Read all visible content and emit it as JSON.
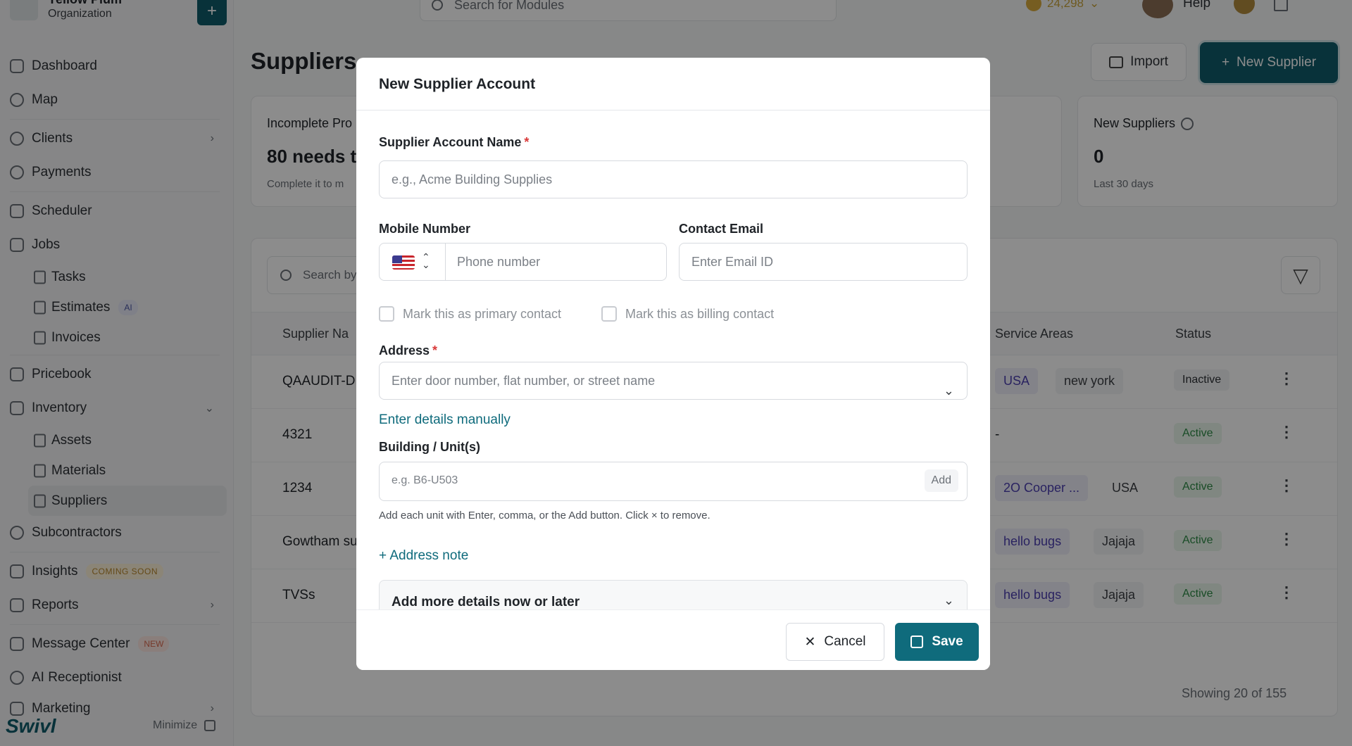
{
  "org": {
    "name": "Yellow Plum",
    "subtitle": "Organization",
    "add_symbol": "+"
  },
  "sidebar": {
    "items": [
      {
        "label": "Dashboard"
      },
      {
        "label": "Map"
      },
      {
        "label": "Clients"
      },
      {
        "label": "Payments"
      },
      {
        "label": "Scheduler"
      },
      {
        "label": "Jobs"
      },
      {
        "label": "Tasks"
      },
      {
        "label": "Estimates",
        "badge": "AI"
      },
      {
        "label": "Invoices"
      },
      {
        "label": "Pricebook"
      },
      {
        "label": "Inventory"
      },
      {
        "label": "Assets"
      },
      {
        "label": "Materials"
      },
      {
        "label": "Suppliers"
      },
      {
        "label": "Subcontractors"
      },
      {
        "label": "Insights",
        "badge": "COMING SOON"
      },
      {
        "label": "Reports"
      },
      {
        "label": "Message Center",
        "badge": "NEW"
      },
      {
        "label": "AI Receptionist"
      },
      {
        "label": "Marketing"
      }
    ],
    "brand": "Swivl",
    "minimize_label": "Minimize"
  },
  "topbar": {
    "search_placeholder": "Search for Modules",
    "coins": "24,298",
    "help_label": "Help"
  },
  "page": {
    "title": "Suppliers",
    "import_label": "Import",
    "new_supplier_label": "New Supplier"
  },
  "cards": {
    "incomplete": {
      "title": "Incomplete Pro",
      "value": "80 needs t",
      "sub": "Complete it to m"
    },
    "new_suppliers": {
      "title": "New Suppliers",
      "value": "0",
      "sub": "Last 30 days"
    }
  },
  "table": {
    "search_placeholder": "Search by",
    "headers": {
      "name": "Supplier Na",
      "service_areas": "Service Areas",
      "status": "Status"
    },
    "rows": [
      {
        "name": "QAAUDIT-DE",
        "area1": "USA",
        "area2": "new york",
        "status": "Inactive"
      },
      {
        "name": "4321",
        "area1": "-",
        "area2": "",
        "status": "Active"
      },
      {
        "name": "1234",
        "area1": "2O Cooper ...",
        "area2": "USA",
        "status": "Active"
      },
      {
        "name": "Gowtham su",
        "area1": "hello bugs",
        "area2": "Jajaja",
        "status": "Active"
      },
      {
        "name": "TVSs",
        "area1": "hello bugs",
        "area2": "Jajaja",
        "status": "Active"
      }
    ],
    "showing": "Showing 20 of 155"
  },
  "modal": {
    "title": "New Supplier Account",
    "account_name_label": "Supplier Account Name",
    "account_name_placeholder": "e.g., Acme Building Supplies",
    "mobile_label": "Mobile Number",
    "phone_placeholder": "Phone number",
    "email_label": "Contact Email",
    "email_placeholder": "Enter Email ID",
    "primary_contact_label": "Mark this as primary contact",
    "billing_contact_label": "Mark this as billing contact",
    "address_label": "Address",
    "address_placeholder": "Enter door number, flat number, or street name",
    "manual_link": "Enter details manually",
    "building_label": "Building / Unit(s)",
    "building_placeholder": "e.g. B6-U503",
    "add_label": "Add",
    "building_hint": "Add each unit with Enter, comma, or the Add button. Click × to remove.",
    "address_note_link": "+ Address note",
    "more_details_label": "Add more details now or later",
    "cancel_label": "Cancel",
    "save_label": "Save",
    "required_mark": "*"
  },
  "colors": {
    "primary": "#0f6b7c",
    "required": "#d93a3a",
    "overlay": "rgba(0,0,0,0.45)"
  },
  "icons": [
    "home-icon",
    "globe-icon",
    "users-icon",
    "payments-icon",
    "calendar-icon",
    "briefcase-icon",
    "search-icon",
    "bell-icon",
    "filter-icon",
    "kebab-icon",
    "chevron-down-icon",
    "close-icon",
    "save-icon",
    "us-flag-icon"
  ]
}
